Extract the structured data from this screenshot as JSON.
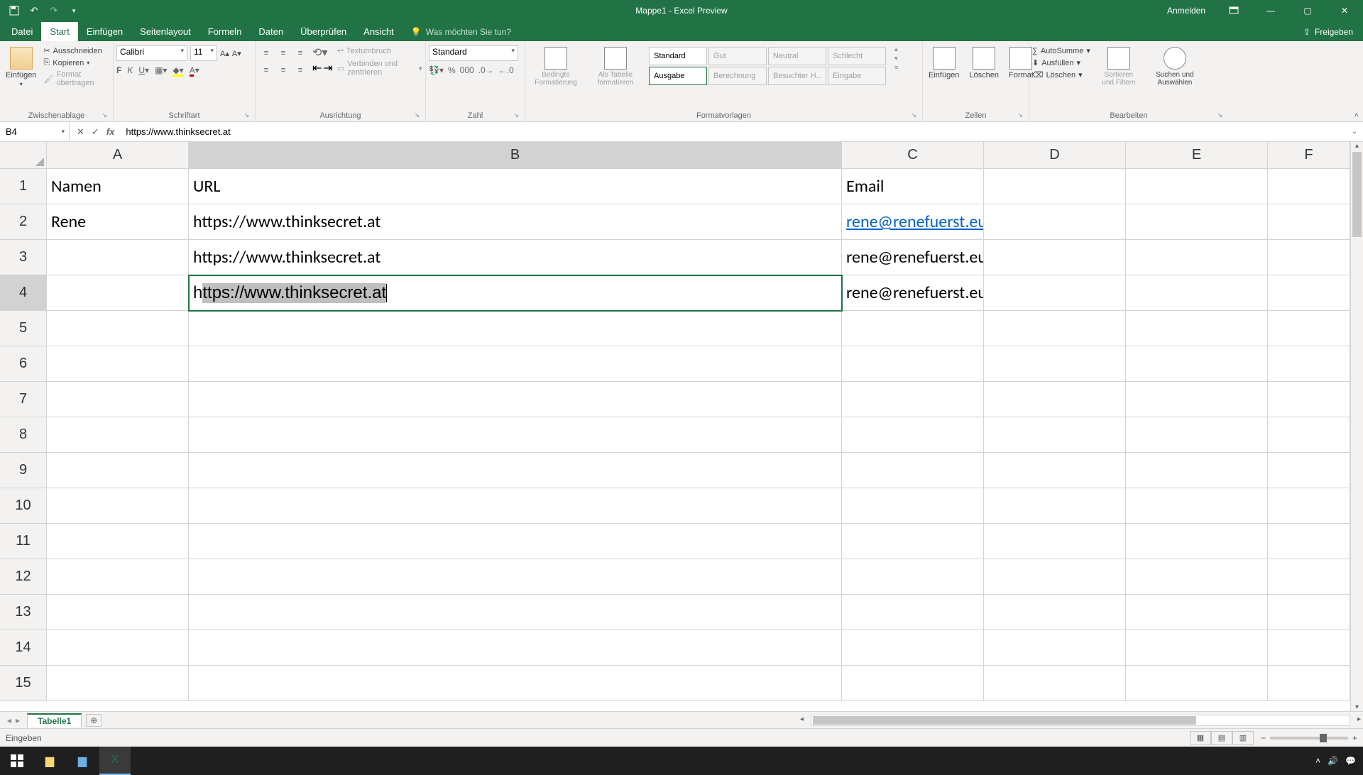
{
  "title": "Mappe1 - Excel Preview",
  "login": "Anmelden",
  "tabs": {
    "datei": "Datei",
    "start": "Start",
    "einfuegen": "Einfügen",
    "seitenlayout": "Seitenlayout",
    "formeln": "Formeln",
    "daten": "Daten",
    "ueberpruefen": "Überprüfen",
    "ansicht": "Ansicht",
    "tellme": "Was möchten Sie tun?",
    "freigeben": "Freigeben"
  },
  "ribbon": {
    "clipboard": {
      "einfuegen": "Einfügen",
      "ausschneiden": "Ausschneiden",
      "kopieren": "Kopieren",
      "format_uebertragen": "Format übertragen",
      "label": "Zwischenablage"
    },
    "font": {
      "name": "Calibri",
      "size": "11",
      "label": "Schriftart"
    },
    "alignment": {
      "textumbruch": "Textumbruch",
      "verbinden": "Verbinden und zentrieren",
      "label": "Ausrichtung"
    },
    "number": {
      "format": "Standard",
      "label": "Zahl"
    },
    "styles": {
      "bedingte": "Bedingte Formatierung",
      "alstabelle": "Als Tabelle formatieren",
      "s1": "Standard",
      "s2": "Gut",
      "s3": "Neutral",
      "s4": "Schlecht",
      "s5": "Ausgabe",
      "s6": "Berechnung",
      "s7": "Besuchter H...",
      "s8": "Eingabe",
      "label": "Formatvorlagen"
    },
    "cells": {
      "einfuegen": "Einfügen",
      "loeschen": "Löschen",
      "format": "Format",
      "label": "Zellen"
    },
    "editing": {
      "autosumme": "AutoSumme",
      "ausfuellen": "Ausfüllen",
      "loeschen": "Löschen",
      "sortieren": "Sortieren und Filtern",
      "suchen": "Suchen und Auswählen",
      "label": "Bearbeiten"
    }
  },
  "name_box": "B4",
  "formula_bar": "https://www.thinksecret.at",
  "columns": [
    "A",
    "B",
    "C",
    "D",
    "E",
    "F"
  ],
  "rows": [
    "1",
    "2",
    "3",
    "4",
    "5",
    "6",
    "7",
    "8",
    "9",
    "10",
    "11",
    "12",
    "13",
    "14",
    "15"
  ],
  "active": {
    "col": "B",
    "row": "4"
  },
  "sheet": {
    "r1": {
      "A": "Namen",
      "B": "URL",
      "C": "Email"
    },
    "r2": {
      "A": "Rene",
      "B": "https://www.thinksecret.at",
      "C": "rene@renefuerst.eu"
    },
    "r3": {
      "B": "https://www.thinksecret.at",
      "C": "rene@renefuerst.eu"
    },
    "r4": {
      "B_pre": "h",
      "B_sel": "ttps://www.thinksecret.at",
      "C": "rene@renefuerst.eu"
    }
  },
  "sheet_tab": "Tabelle1",
  "status_mode": "Eingeben"
}
